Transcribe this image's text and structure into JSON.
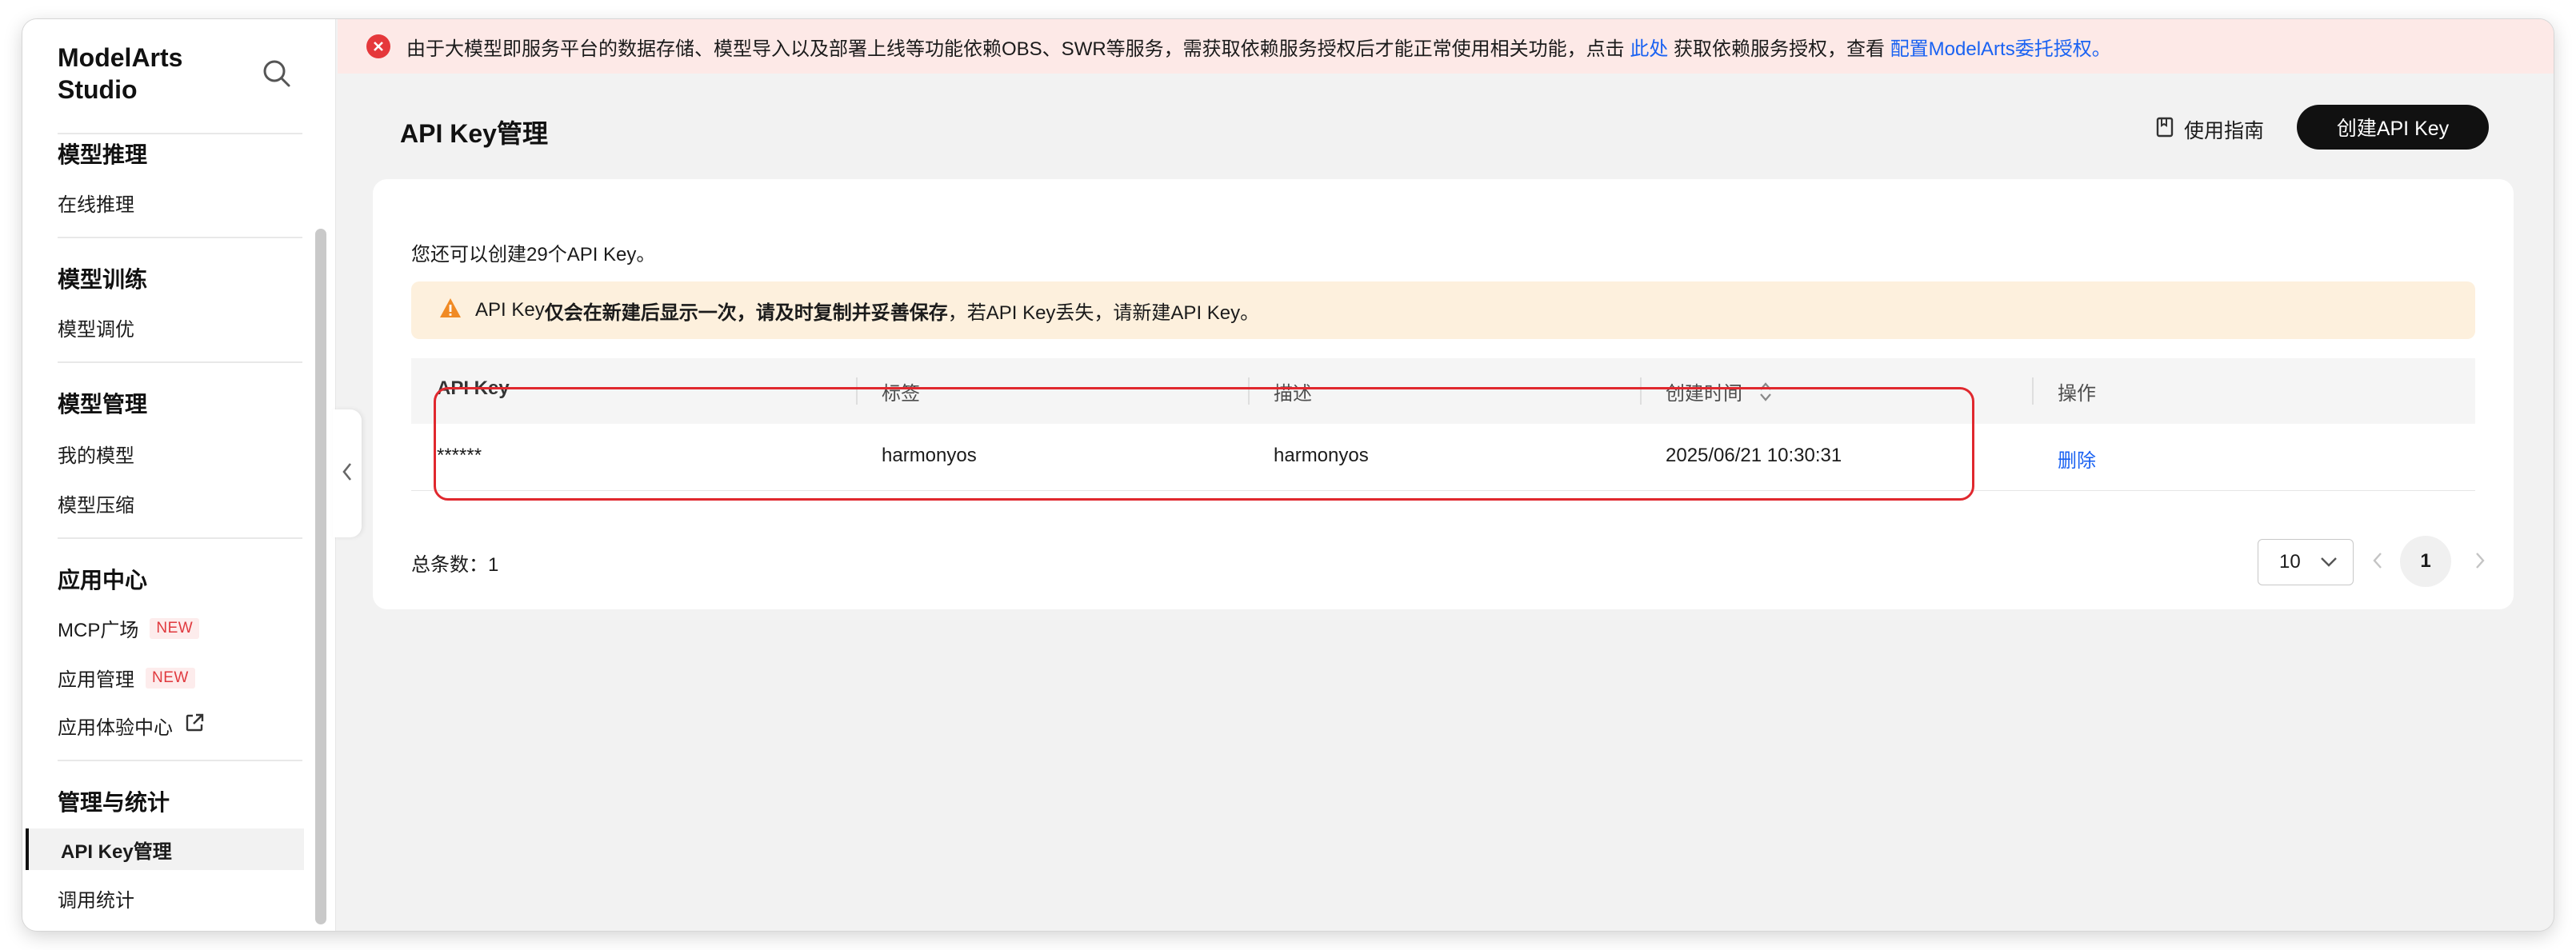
{
  "sidebar": {
    "brand": "ModelArts\nStudio",
    "sections": [
      {
        "title": "模型推理",
        "items": [
          {
            "label": "在线推理"
          }
        ]
      },
      {
        "title": "模型训练",
        "items": [
          {
            "label": "模型调优"
          }
        ]
      },
      {
        "title": "模型管理",
        "items": [
          {
            "label": "我的模型"
          },
          {
            "label": "模型压缩"
          }
        ]
      },
      {
        "title": "应用中心",
        "items": [
          {
            "label": "MCP广场",
            "badge": "NEW"
          },
          {
            "label": "应用管理",
            "badge": "NEW"
          },
          {
            "label": "应用体验中心"
          }
        ]
      },
      {
        "title": "管理与统计",
        "items": [
          {
            "label": "API Key管理"
          },
          {
            "label": "调用统计"
          }
        ]
      }
    ]
  },
  "banner": {
    "text_before": "由于大模型即服务平台的数据存储、模型导入以及部署上线等功能依赖OBS、SWR等服务，需获取依赖服务授权后才能正常使用相关功能，点击",
    "link1": "此处",
    "text_middle": "获取依赖服务授权，查看",
    "link2": "配置ModelArts委托授权。"
  },
  "header": {
    "title": "API Key管理",
    "guide_label": "使用指南",
    "create_label": "创建API Key"
  },
  "card": {
    "remaining_text": "您还可以创建29个API Key。",
    "warning": {
      "prefix": "API Key",
      "bold": "仅会在新建后显示一次，请及时复制并妥善保存",
      "suffix": "，若API Key丢失，请新建API Key。"
    },
    "table": {
      "headers": [
        "API Key",
        "标签",
        "描述",
        "创建时间",
        "操作"
      ],
      "rows": [
        {
          "api_key": "******",
          "tag": "harmonyos",
          "desc": "harmonyos",
          "created": "2025/06/21 10:30:31",
          "action": "删除"
        }
      ]
    },
    "total_text": "总条数：1",
    "page_size": "10",
    "current_page": "1"
  },
  "colors": {
    "accent": "#1a62f2",
    "error": "#e5383b",
    "highlight": "#e0282e",
    "warning_bg": "#fdf0dd"
  }
}
